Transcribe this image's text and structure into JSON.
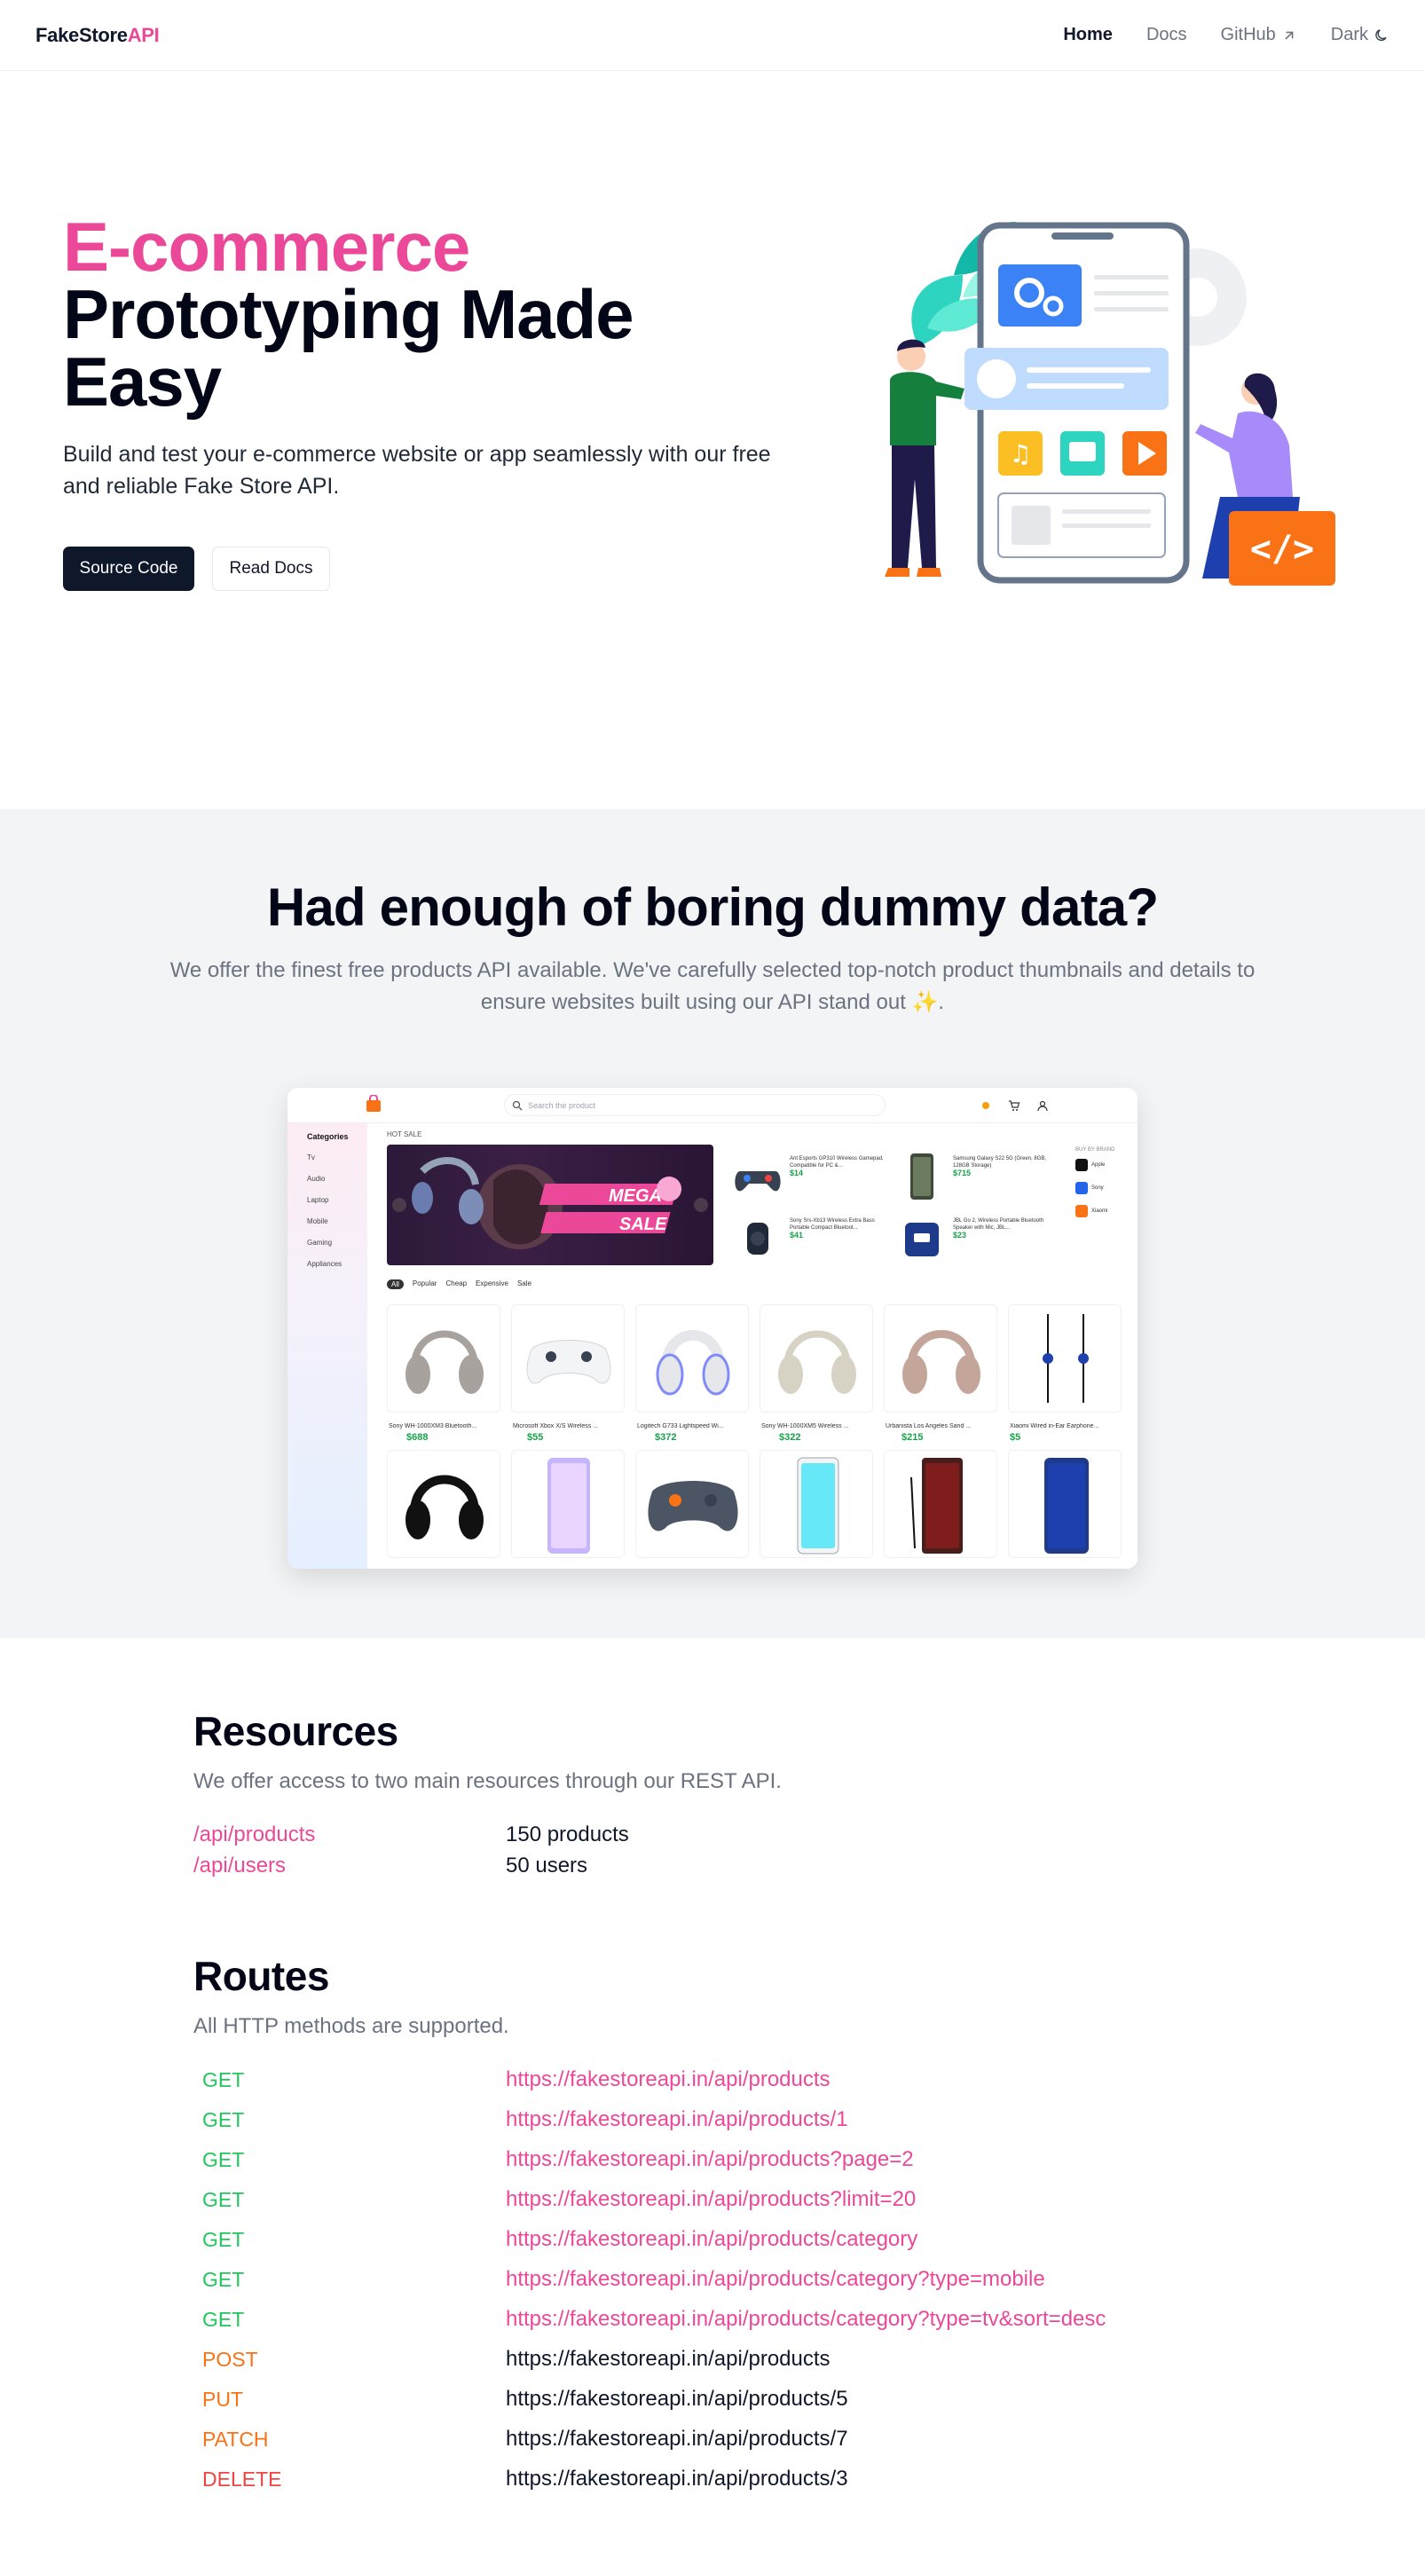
{
  "nav": {
    "logo_main": "FakeStore",
    "logo_accent": "API",
    "links": [
      {
        "label": "Home"
      },
      {
        "label": "Docs"
      },
      {
        "label": "GitHub"
      },
      {
        "label": "Dark"
      }
    ]
  },
  "hero": {
    "title_accent": "E-commerce",
    "title_rest": "Prototyping Made Easy",
    "subtitle": "Build and test your e-commerce website or app seamlessly with our free and reliable Fake Store API.",
    "primary_button": "Source Code",
    "secondary_button": "Read Docs"
  },
  "feature": {
    "title": "Had enough of boring dummy data?",
    "subtitle": "We offer the finest free products API available. We've carefully selected top-notch product thumbnails and details to ensure websites built using our API stand out ✨.",
    "mock": {
      "search_placeholder": "Search the product",
      "categories_title": "Categories",
      "categories": [
        "Tv",
        "Audio",
        "Laptop",
        "Mobile",
        "Gaming",
        "Appliances"
      ],
      "hot_sale": "HOT SALE",
      "banner_text_1": "MEGA",
      "banner_text_2": "SALE",
      "tabs": [
        "All",
        "Popular",
        "Cheap",
        "Expensive",
        "Sale"
      ],
      "mini_products": [
        {
          "name": "Ant Esports GP310 Wireless Gamepad, Compatible for PC &...",
          "price": "$14"
        },
        {
          "name": "Samsung Galaxy S22 5G (Green, 8GB, 128GB Storage)",
          "price": "$715"
        },
        {
          "name": "Sony Srs-Xb13 Wireless Extra Bass Portable Compact Bluetoot...",
          "price": "$41"
        },
        {
          "name": "JBL Go 2, Wireless Portable Bluetooth Speaker with Mic, JBL...",
          "price": "$23"
        }
      ],
      "brands_title": "BUY BY BRAND",
      "brands": [
        "Apple",
        "Sony",
        "Xiaomi"
      ],
      "products": [
        {
          "name": "Sony WH-1000XM3 Bluetooth...",
          "price": "$688"
        },
        {
          "name": "Microsoft Xbox X/S Wireless ...",
          "price": "$55"
        },
        {
          "name": "Logitech G733 Lightspeed Wi...",
          "price": "$372"
        },
        {
          "name": "Sony WH-1000XM5 Wireless ...",
          "price": "$322"
        },
        {
          "name": "Urbanista Los Angeles Sand ...",
          "price": "$215"
        },
        {
          "name": "Xiaomi Wired in-Ear Earphone...",
          "price": "$5"
        }
      ]
    }
  },
  "resources": {
    "title": "Resources",
    "subtitle": "We offer access to two main resources through our REST API.",
    "items": [
      {
        "path": "/api/products",
        "value": "150 products"
      },
      {
        "path": "/api/users",
        "value": "50 users"
      }
    ]
  },
  "routes": {
    "title": "Routes",
    "subtitle": "All HTTP methods are supported.",
    "items": [
      {
        "method": "GET",
        "url": "https://fakestoreapi.in/api/products"
      },
      {
        "method": "GET",
        "url": "https://fakestoreapi.in/api/products/1"
      },
      {
        "method": "GET",
        "url": "https://fakestoreapi.in/api/products?page=2"
      },
      {
        "method": "GET",
        "url": "https://fakestoreapi.in/api/products?limit=20"
      },
      {
        "method": "GET",
        "url": "https://fakestoreapi.in/api/products/category"
      },
      {
        "method": "GET",
        "url": "https://fakestoreapi.in/api/products/category?type=mobile"
      },
      {
        "method": "GET",
        "url": "https://fakestoreapi.in/api/products/category?type=tv&sort=desc"
      },
      {
        "method": "POST",
        "url": "https://fakestoreapi.in/api/products"
      },
      {
        "method": "PUT",
        "url": "https://fakestoreapi.in/api/products/5"
      },
      {
        "method": "PATCH",
        "url": "https://fakestoreapi.in/api/products/7"
      },
      {
        "method": "DELETE",
        "url": "https://fakestoreapi.in/api/products/3"
      }
    ]
  },
  "colors": {
    "accent": "#ec4899",
    "get": "#22c55e",
    "write": "#f97316",
    "delete": "#ef4444"
  }
}
